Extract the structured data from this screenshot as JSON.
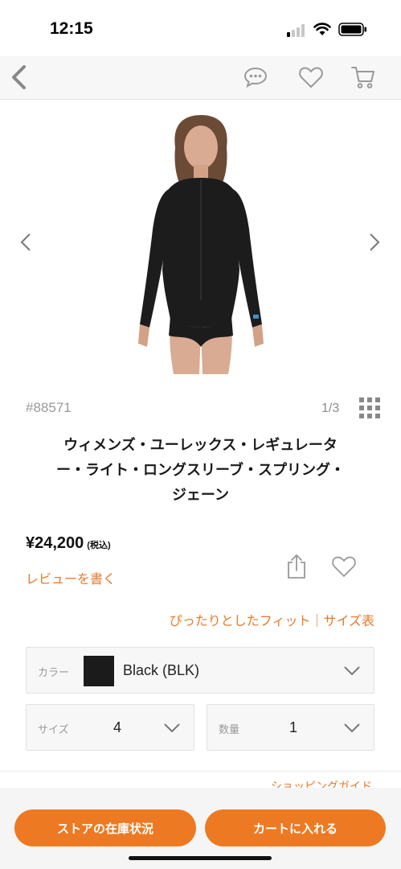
{
  "status": {
    "time": "12:15"
  },
  "nav": {
    "back_icon": "chevron-left-icon",
    "chat_icon": "speech-bubble-icon",
    "favorite_icon": "heart-icon",
    "cart_icon": "cart-icon"
  },
  "product": {
    "sku": "#88571",
    "image_index": "1/3",
    "title_lines": [
      "ウィメンズ・ユーレックス・レギュレータ",
      "ー・ライト・ロングスリーブ・スプリング・",
      "ジェーン"
    ],
    "price": "¥24,200",
    "tax_note": "(税込)",
    "review_link": "レビューを書く",
    "fit_link": "ぴったりとしたフィット｜サイズ表"
  },
  "options": {
    "color": {
      "label": "カラー",
      "value": "Black (BLK)",
      "swatch": "#1b1b1b"
    },
    "size": {
      "label": "サイズ",
      "value": "4"
    },
    "quantity": {
      "label": "数量",
      "value": "1"
    }
  },
  "footer": {
    "shopping_guide": "ショッピングガイド",
    "store_stock_button": "ストアの在庫状況",
    "add_to_cart_button": "カートに入れる"
  },
  "colors": {
    "accent": "#ed7a22",
    "link": "#e8792a"
  }
}
